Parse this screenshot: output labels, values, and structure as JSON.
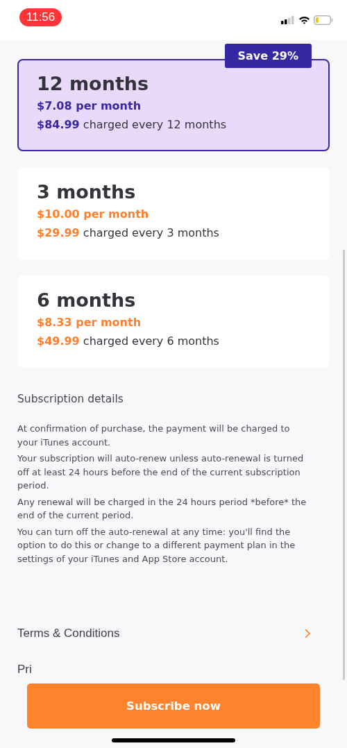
{
  "status_bar": {
    "time": "11:56"
  },
  "plans": [
    {
      "title": "12 months",
      "per_month": "$7.08 per month",
      "charged": "**$84.99** charged every 12 months",
      "selected": true,
      "badge": "Save 29%"
    },
    {
      "title": "3 months",
      "per_month": "$10.00 per month",
      "charged": "**$29.99** charged every 3 months",
      "selected": false
    },
    {
      "title": "6 months",
      "per_month": "$8.33 per month",
      "charged": "**$49.99** charged every 6 months",
      "selected": false
    }
  ],
  "details": {
    "heading": "Subscription details",
    "paragraphs": [
      "At confirmation of purchase, the payment will be charged to your iTunes account.",
      "Your subscription will auto-renew unless auto-renewal is turned off at least 24 hours before the end of the current subscription period.",
      "Any renewal will be charged in the 24 hours period *before* the end of the current period.",
      "You can turn off the auto-renewal at any time: you'll find the option to do this or change to a different payment plan in the settings of your iTunes and App Store account."
    ]
  },
  "links": [
    {
      "label": "Terms & Conditions"
    },
    {
      "label": "Pri"
    }
  ],
  "subscribe_button": "Subscribe now"
}
